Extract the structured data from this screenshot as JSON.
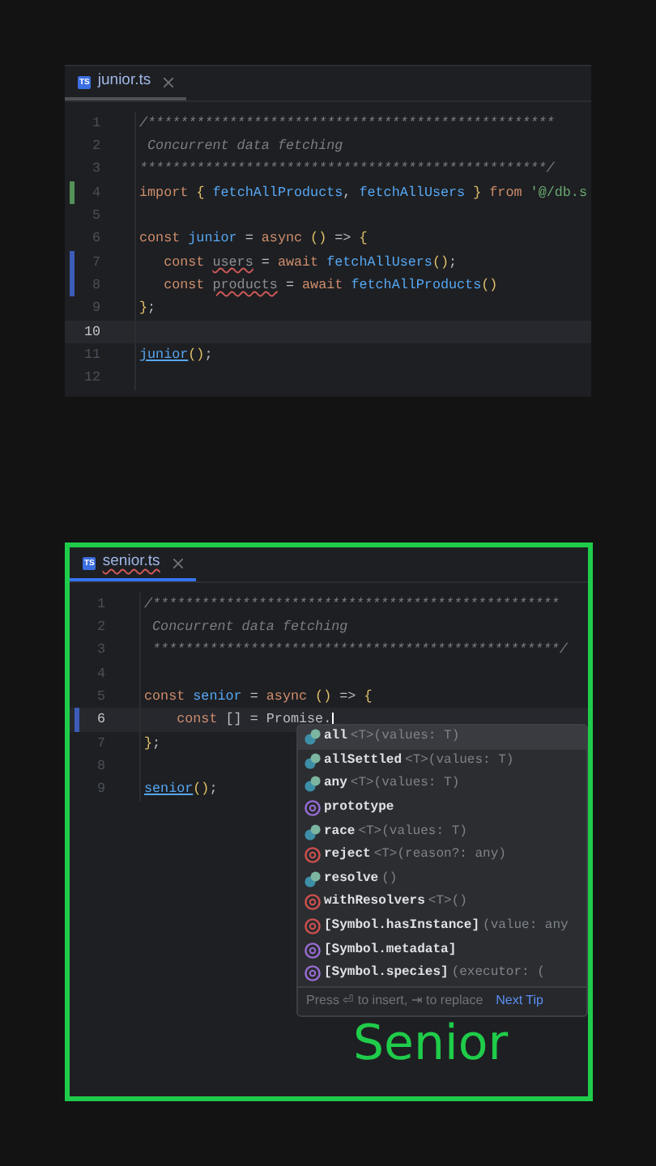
{
  "editors": [
    {
      "tab": {
        "label": "junior.ts",
        "icon": "TS",
        "selected": false,
        "error": false
      },
      "framed": false,
      "lines": [
        {
          "n": "1",
          "current": false,
          "tokens": [
            {
              "kind": "comment",
              "text": "/**************************************************"
            }
          ]
        },
        {
          "n": "2",
          "current": false,
          "tokens": [
            {
              "kind": "comment",
              "text": " Concurrent data fetching"
            }
          ]
        },
        {
          "n": "3",
          "current": false,
          "tokens": [
            {
              "kind": "comment",
              "text": "**************************************************/"
            }
          ]
        },
        {
          "n": "4",
          "color": "#549159",
          "current": false,
          "tokens": [
            {
              "kind": "keyword",
              "text": "import "
            },
            {
              "kind": "brace",
              "text": "{ "
            },
            {
              "kind": "fn",
              "text": "fetchAllProducts"
            },
            {
              "kind": "plain",
              "text": ", "
            },
            {
              "kind": "fn",
              "text": "fetchAllUsers"
            },
            {
              "kind": "brace",
              "text": " } "
            },
            {
              "kind": "keyword",
              "text": "from "
            },
            {
              "kind": "string",
              "text": "'@/db.s"
            }
          ]
        },
        {
          "n": "5",
          "current": false
        },
        {
          "n": "6",
          "current": false,
          "tokens": [
            {
              "kind": "keyword",
              "text": "const "
            },
            {
              "kind": "fn",
              "text": "junior"
            },
            {
              "kind": "plain",
              "text": " = "
            },
            {
              "kind": "keyword",
              "text": "async "
            },
            {
              "kind": "brace",
              "text": "() "
            },
            {
              "kind": "plain",
              "text": "=> "
            },
            {
              "kind": "brace",
              "text": "{"
            }
          ]
        },
        {
          "n": "7",
          "color": "#3b5cb8",
          "current": false,
          "tokens": [
            {
              "kind": "keyword",
              "text": "   const "
            },
            {
              "kind": "unused",
              "text": "users"
            },
            {
              "kind": "plain",
              "text": " = "
            },
            {
              "kind": "keyword",
              "text": "await "
            },
            {
              "kind": "fn",
              "text": "fetchAllUsers"
            },
            {
              "kind": "brace",
              "text": "()"
            },
            {
              "kind": "plain",
              "text": ";"
            }
          ]
        },
        {
          "n": "8",
          "color": "#3b5cb8",
          "current": false,
          "tokens": [
            {
              "kind": "keyword",
              "text": "   const "
            },
            {
              "kind": "unused",
              "text": "products"
            },
            {
              "kind": "plain",
              "text": " = "
            },
            {
              "kind": "keyword",
              "text": "await "
            },
            {
              "kind": "fn",
              "text": "fetchAllProducts"
            },
            {
              "kind": "brace",
              "text": "()"
            }
          ]
        },
        {
          "n": "9",
          "current": false,
          "tokens": [
            {
              "kind": "brace",
              "text": "}"
            },
            {
              "kind": "plain",
              "text": ";"
            }
          ]
        },
        {
          "n": "10",
          "current": true
        },
        {
          "n": "11",
          "current": false,
          "tokens": [
            {
              "kind": "call",
              "text": "junior"
            },
            {
              "kind": "brace",
              "text": "()"
            },
            {
              "kind": "plain",
              "text": ";"
            }
          ]
        },
        {
          "n": "12",
          "current": false
        }
      ]
    },
    {
      "tab": {
        "label": "senior.ts",
        "icon": "TS",
        "selected": true,
        "error": true
      },
      "framed": true,
      "lines": [
        {
          "n": "1",
          "current": false,
          "tokens": [
            {
              "kind": "comment",
              "text": "/**************************************************"
            }
          ]
        },
        {
          "n": "2",
          "current": false,
          "tokens": [
            {
              "kind": "comment",
              "text": " Concurrent data fetching"
            }
          ]
        },
        {
          "n": "3",
          "current": false,
          "tokens": [
            {
              "kind": "comment",
              "text": " **************************************************/"
            }
          ]
        },
        {
          "n": "4",
          "current": false
        },
        {
          "n": "5",
          "current": false,
          "tokens": [
            {
              "kind": "keyword",
              "text": "const "
            },
            {
              "kind": "fn",
              "text": "senior"
            },
            {
              "kind": "plain",
              "text": " = "
            },
            {
              "kind": "keyword",
              "text": "async "
            },
            {
              "kind": "brace",
              "text": "() "
            },
            {
              "kind": "plain",
              "text": "=> "
            },
            {
              "kind": "brace",
              "text": "{"
            }
          ]
        },
        {
          "n": "6",
          "color": "#3b5cb8",
          "current": true,
          "tokens": [
            {
              "kind": "keyword",
              "text": "    const "
            },
            {
              "kind": "plain",
              "text": "[] = Promise."
            }
          ]
        },
        {
          "n": "7",
          "current": false,
          "tokens": [
            {
              "kind": "brace",
              "text": "}"
            },
            {
              "kind": "plain",
              "text": ";"
            }
          ]
        },
        {
          "n": "8",
          "current": false
        },
        {
          "n": "9",
          "current": false,
          "tokens": [
            {
              "kind": "call",
              "text": "senior"
            },
            {
              "kind": "brace",
              "text": "()"
            },
            {
              "kind": "plain",
              "text": ";"
            }
          ]
        }
      ],
      "completion": {
        "items": [
          {
            "kind": "method",
            "name": "all",
            "detail": "<T>(values: T)",
            "selected": true
          },
          {
            "kind": "method",
            "name": "allSettled",
            "detail": "<T>(values: T)",
            "selected": false
          },
          {
            "kind": "method",
            "name": "any",
            "detail": "<T>(values: T)",
            "selected": false
          },
          {
            "kind": "property",
            "name": "prototype",
            "selected": false
          },
          {
            "kind": "method",
            "name": "race",
            "detail": "<T>(values: T)",
            "selected": false
          },
          {
            "kind": "member",
            "name": "reject",
            "detail": "<T>(reason?: any)",
            "selected": false
          },
          {
            "kind": "method",
            "name": "resolve",
            "detail": "()",
            "selected": false
          },
          {
            "kind": "member",
            "name": "withResolvers",
            "detail": "<T>()",
            "selected": false
          },
          {
            "kind": "member",
            "name": "[Symbol.hasInstance]",
            "detail": "(value: any",
            "selected": false
          },
          {
            "kind": "property",
            "name": "[Symbol.metadata]",
            "selected": false
          },
          {
            "kind": "property",
            "name": "[Symbol.species]",
            "detail": "(executor: (",
            "selected": false
          }
        ],
        "hint": "Press ⏎ to insert, ⇥ to replace",
        "tip_link": "Next Tip"
      },
      "caption": "Senior"
    }
  ]
}
